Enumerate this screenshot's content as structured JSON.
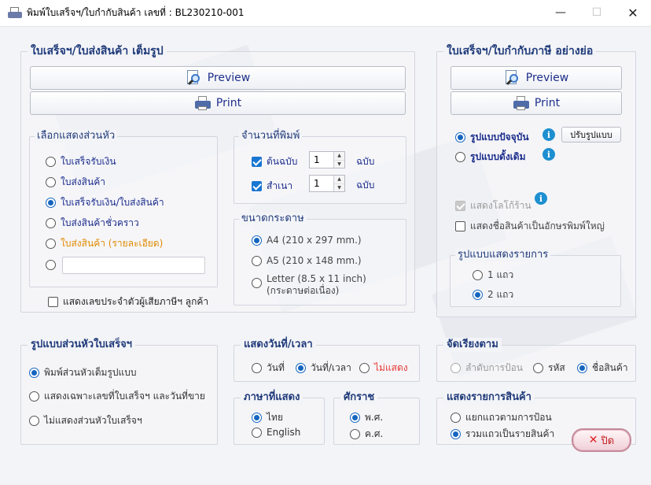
{
  "window": {
    "title": "พิมพ์ใบเสร็จฯ/ใบกำกับสินค้า เลขที่ : BL230210-001",
    "minimize_glyph": "—",
    "maximize_glyph": "☐",
    "close_glyph": "✕"
  },
  "full_format": {
    "title": "ใบเสร็จฯ/ใบส่งสินค้า เต็มรูป",
    "preview_label": "Preview",
    "print_label": "Print",
    "header_select": {
      "title": "เลือกแสดงส่วนหัว",
      "options": [
        "ใบเสร็จรับเงิน",
        "ใบส่งสินค้า",
        "ใบเสร็จรับเงิน/ใบส่งสินค้า",
        "ใบส่งสินค้าชั่วคราว",
        "ใบส่งสินค้า (รายละเอียด)",
        ""
      ],
      "selected_index": 2,
      "custom_value": ""
    },
    "show_tax_id_label": "แสดงเลขประจำตัวผู้เสียภาษีฯ ลูกค้า",
    "show_tax_id_checked": false,
    "copies": {
      "title": "จำนวนที่พิมพ์",
      "original_label": "ต้นฉบับ",
      "original_checked": true,
      "original_count": "1",
      "copy_label": "สำเนา",
      "copy_checked": true,
      "copy_count": "1",
      "unit": "ฉบับ"
    },
    "paper": {
      "title": "ขนาดกระดาษ",
      "options": [
        "A4 (210 x 297 mm.)",
        "A5 (210 x 148 mm.)",
        "Letter (8.5 x 11 inch)"
      ],
      "letter_note": "(กระดาษต่อเนื่อง)",
      "selected_index": 0
    }
  },
  "short_format": {
    "title": "ใบเสร็จฯ/ใบกำกับภาษี อย่างย่อ",
    "preview_label": "Preview",
    "print_label": "Print",
    "style_current_label": "รูปแบบปัจจุบัน",
    "style_old_label": "รูปแบบดั้งเดิม",
    "style_selected_index": 0,
    "info_glyph": "i",
    "customize_label": "ปรับรูปแบบ",
    "show_logo_label": "แสดงโลโก้ร้าน",
    "show_logo_checked": true,
    "big_font_label": "แสดงชื่อสินค้าเป็นอักษรพิมพ์ใหญ่",
    "big_font_checked": false,
    "line_style": {
      "title": "รูปแบบแสดงรายการ",
      "options": [
        "1 แถว",
        "2 แถว"
      ],
      "selected_index": 1
    }
  },
  "header_style": {
    "title": "รูปแบบส่วนหัวใบเสร็จฯ",
    "options": [
      "พิมพ์ส่วนหัวเต็มรูปแบบ",
      "แสดงเฉพาะเลขที่ใบเสร็จฯ และวันที่ขาย",
      "ไม่แสดงส่วนหัวใบเสร็จฯ"
    ],
    "selected_index": 0
  },
  "date_time": {
    "title": "แสดงวันที่/เวลา",
    "options": [
      "วันที่",
      "วันที่/เวลา",
      "ไม่แสดง"
    ],
    "selected_index": 1
  },
  "language": {
    "title": "ภาษาที่แสดง",
    "options": [
      "ไทย",
      "English"
    ],
    "selected_index": 0
  },
  "era": {
    "title": "ศักราช",
    "options": [
      "พ.ศ.",
      "ค.ศ."
    ],
    "selected_index": 0
  },
  "sort_by": {
    "title": "จัดเรียงตาม",
    "options": [
      "ลำดับการป้อน",
      "รหัส",
      "ชื่อสินค้า"
    ],
    "selected_index": 2
  },
  "item_display": {
    "title": "แสดงรายการสินค้า",
    "options": [
      "แยกแถวตามการป้อน",
      "รวมแถวเป็นรายสินค้า"
    ],
    "selected_index": 1
  },
  "close_button": {
    "icon": "✕",
    "label": "ปิด"
  },
  "colors": {
    "accent_blue": "#1565c0",
    "title_blue": "#1f3a7a",
    "orange": "#e08a00",
    "red": "#e53935"
  }
}
